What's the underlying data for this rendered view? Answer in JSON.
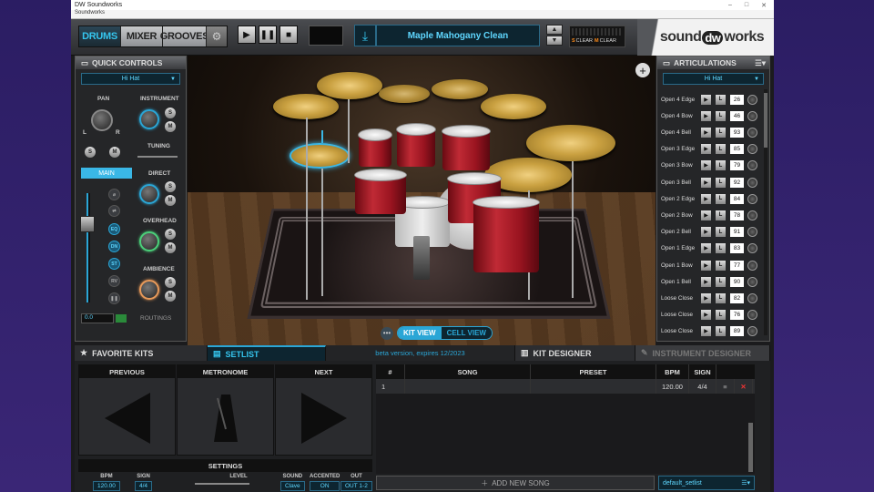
{
  "window": {
    "title": "DW Soundworks",
    "menu": "Soundworks"
  },
  "toolbar": {
    "tabs": [
      "DRUMS",
      "MIXER",
      "GROOVES"
    ],
    "preset_name": "Maple Mahogany Clean",
    "clear_s": "CLEAR",
    "clear_m": "CLEAR",
    "s": "S",
    "m": "M"
  },
  "logo": {
    "a": "sound",
    "b": "dw",
    "c": "works"
  },
  "quick_controls": {
    "title": "QUICK CONTROLS",
    "selected": "Hi Hat",
    "pan": "PAN",
    "instrument": "INSTRUMENT",
    "tuning": "TUNING",
    "main": "MAIN",
    "direct": "DIRECT",
    "overhead": "OVERHEAD",
    "ambience": "AMBIENCE",
    "volume": "0.0",
    "routings": "ROUTINGS",
    "l": "L",
    "r": "R",
    "eq": "EQ",
    "dn": "DN",
    "st": "ST",
    "rv": "RV"
  },
  "view": {
    "kit_view": "KIT VIEW",
    "cell_view": "CELL VIEW",
    "kick_logo": "dw"
  },
  "articulations": {
    "title": "ARTICULATIONS",
    "selected": "Hi Hat",
    "items": [
      {
        "name": "Open 4 Edge",
        "note": "26"
      },
      {
        "name": "Open 4 Bow",
        "note": "46"
      },
      {
        "name": "Open 4 Bell",
        "note": "93"
      },
      {
        "name": "Open 3 Edge",
        "note": "85"
      },
      {
        "name": "Open 3 Bow",
        "note": "79"
      },
      {
        "name": "Open 3 Bell",
        "note": "92"
      },
      {
        "name": "Open 2 Edge",
        "note": "84"
      },
      {
        "name": "Open 2 Bow",
        "note": "78"
      },
      {
        "name": "Open 2 Bell",
        "note": "91"
      },
      {
        "name": "Open 1 Edge",
        "note": "83"
      },
      {
        "name": "Open 1 Bow",
        "note": "77"
      },
      {
        "name": "Open 1 Bell",
        "note": "90"
      },
      {
        "name": "Loose Close",
        "note": "82"
      },
      {
        "name": "Loose Close",
        "note": "76"
      },
      {
        "name": "Loose Close",
        "note": "89"
      }
    ]
  },
  "bottom_tabs": {
    "favorite_kits": "FAVORITE KITS",
    "setlist": "SETLIST",
    "beta": "beta version, expires 12/2023",
    "kit_designer": "KIT DESIGNER",
    "instrument_designer": "INSTRUMENT DESIGNER"
  },
  "setlist": {
    "previous": "PREVIOUS",
    "metronome": "METRONOME",
    "next": "NEXT",
    "settings": "SETTINGS",
    "bpm_label": "BPM",
    "bpm": "120.00",
    "sign_label": "SIGN",
    "sign": "4/4",
    "level_label": "LEVEL",
    "sound_label": "SOUND",
    "sound": "Clave",
    "accented_label": "ACCENTED",
    "accented": "ON",
    "out_label": "OUT",
    "out": "OUT 1-2",
    "columns": [
      "#",
      "SONG",
      "PRESET",
      "BPM",
      "SIGN"
    ],
    "rows": [
      {
        "num": "1",
        "song": "",
        "preset": "",
        "bpm": "120.00",
        "sign": "4/4"
      }
    ],
    "add_song": "ADD NEW SONG",
    "file": "default_setlist"
  }
}
